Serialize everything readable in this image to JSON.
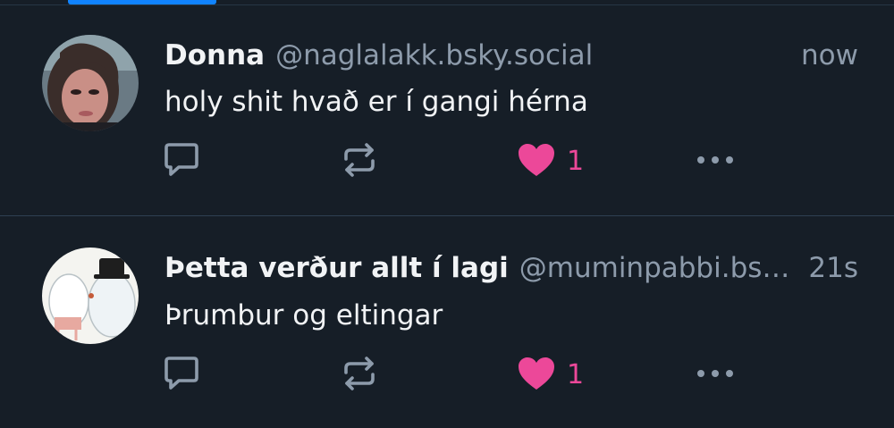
{
  "colors": {
    "background": "#161e27",
    "accent": "#1083fe",
    "like": "#ec4899",
    "secondary_text": "#8d9bab",
    "icon": "#8d9bab"
  },
  "posts": [
    {
      "name": "Donna",
      "handle": "@naglalakk.bsky.social",
      "time": "now",
      "text": "holy shit hvað er í gangi hérna",
      "likes": "1",
      "liked": true
    },
    {
      "name": "Þetta verður allt í lagi",
      "handle": "@muminpabbi.bsk...",
      "time": "21s",
      "text": "Þrumbur og eltingar",
      "likes": "1",
      "liked": true
    }
  ],
  "icons": {
    "reply": "reply-icon",
    "repost": "repost-icon",
    "like": "heart-icon",
    "more": "more-icon"
  }
}
